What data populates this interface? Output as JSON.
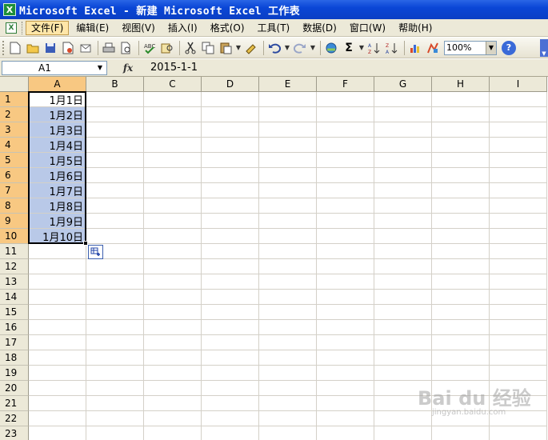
{
  "window": {
    "title": "Microsoft Excel - 新建 Microsoft Excel 工作表"
  },
  "menu": {
    "items": [
      {
        "label": "文件(F)",
        "active": true
      },
      {
        "label": "编辑(E)"
      },
      {
        "label": "视图(V)"
      },
      {
        "label": "插入(I)"
      },
      {
        "label": "格式(O)"
      },
      {
        "label": "工具(T)"
      },
      {
        "label": "数据(D)"
      },
      {
        "label": "窗口(W)"
      },
      {
        "label": "帮助(H)"
      }
    ]
  },
  "toolbar": {
    "zoom": "100%"
  },
  "formula_bar": {
    "name_box": "A1",
    "fx": "fx",
    "value": "2015-1-1"
  },
  "sheet": {
    "columns": [
      "A",
      "B",
      "C",
      "D",
      "E",
      "F",
      "G",
      "H",
      "I"
    ],
    "rows": [
      "1",
      "2",
      "3",
      "4",
      "5",
      "6",
      "7",
      "8",
      "9",
      "10",
      "11",
      "12",
      "13",
      "14",
      "15",
      "16",
      "17",
      "18",
      "19",
      "20",
      "21",
      "22",
      "23"
    ],
    "column_a_values": [
      "1月1日",
      "1月2日",
      "1月3日",
      "1月4日",
      "1月5日",
      "1月6日",
      "1月7日",
      "1月8日",
      "1月9日",
      "1月10日"
    ],
    "selected_column": "A",
    "selected_rows": 10
  },
  "watermark": {
    "text": "Bai du 经验",
    "sub": "jingyan.baidu.com"
  }
}
